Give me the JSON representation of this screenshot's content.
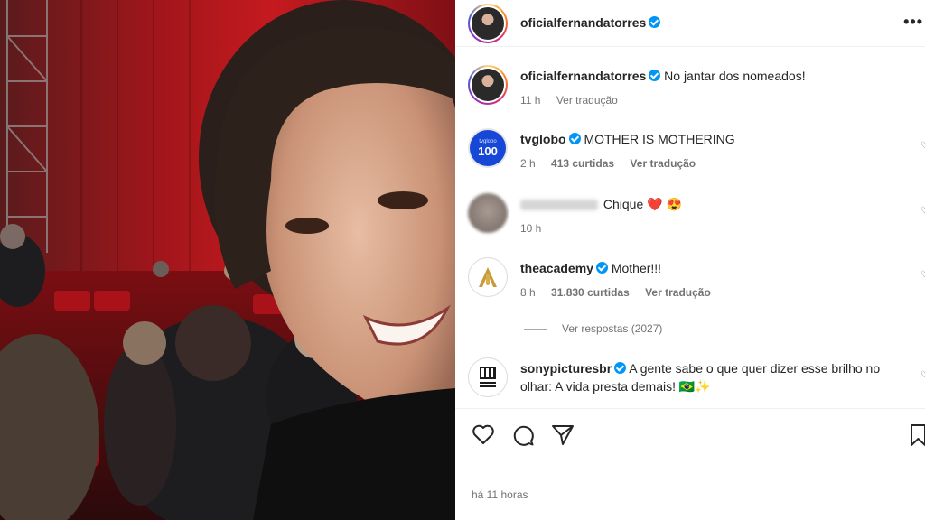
{
  "post": {
    "username": "oficialfernandatorres",
    "more_label": "•••",
    "caption": {
      "username": "oficialfernandatorres",
      "text": "No jantar dos nomeados!",
      "time": "11 h",
      "translate": "Ver tradução"
    },
    "timestamp": "há 11 horas"
  },
  "comments": [
    {
      "username": "tvglobo",
      "verified": true,
      "text": "MOTHER IS MOTHERING",
      "time": "2 h",
      "likes": "413 curtidas",
      "translate": "Ver tradução",
      "avatar_label": "100",
      "avatar_top_label": "tvglobo"
    },
    {
      "username": "",
      "verified": false,
      "text": "Chique ❤️ 😍",
      "time": "10 h"
    },
    {
      "username": "theacademy",
      "verified": true,
      "text": "Mother!!!",
      "time": "8 h",
      "likes": "31.830 curtidas",
      "translate": "Ver tradução",
      "view_replies": "Ver respostas (2027)"
    },
    {
      "username": "sonypicturesbr",
      "verified": true,
      "text": "A gente sabe o que quer dizer esse brilho no olhar: A vida presta demais! 🇧🇷✨"
    }
  ],
  "icons": {
    "like": "heart-icon",
    "comment": "comment-icon",
    "share": "share-icon",
    "save": "bookmark-icon"
  },
  "colors": {
    "verified": "#0095f6",
    "meta": "#737373",
    "text": "#262626",
    "heart": "#ed4956"
  }
}
